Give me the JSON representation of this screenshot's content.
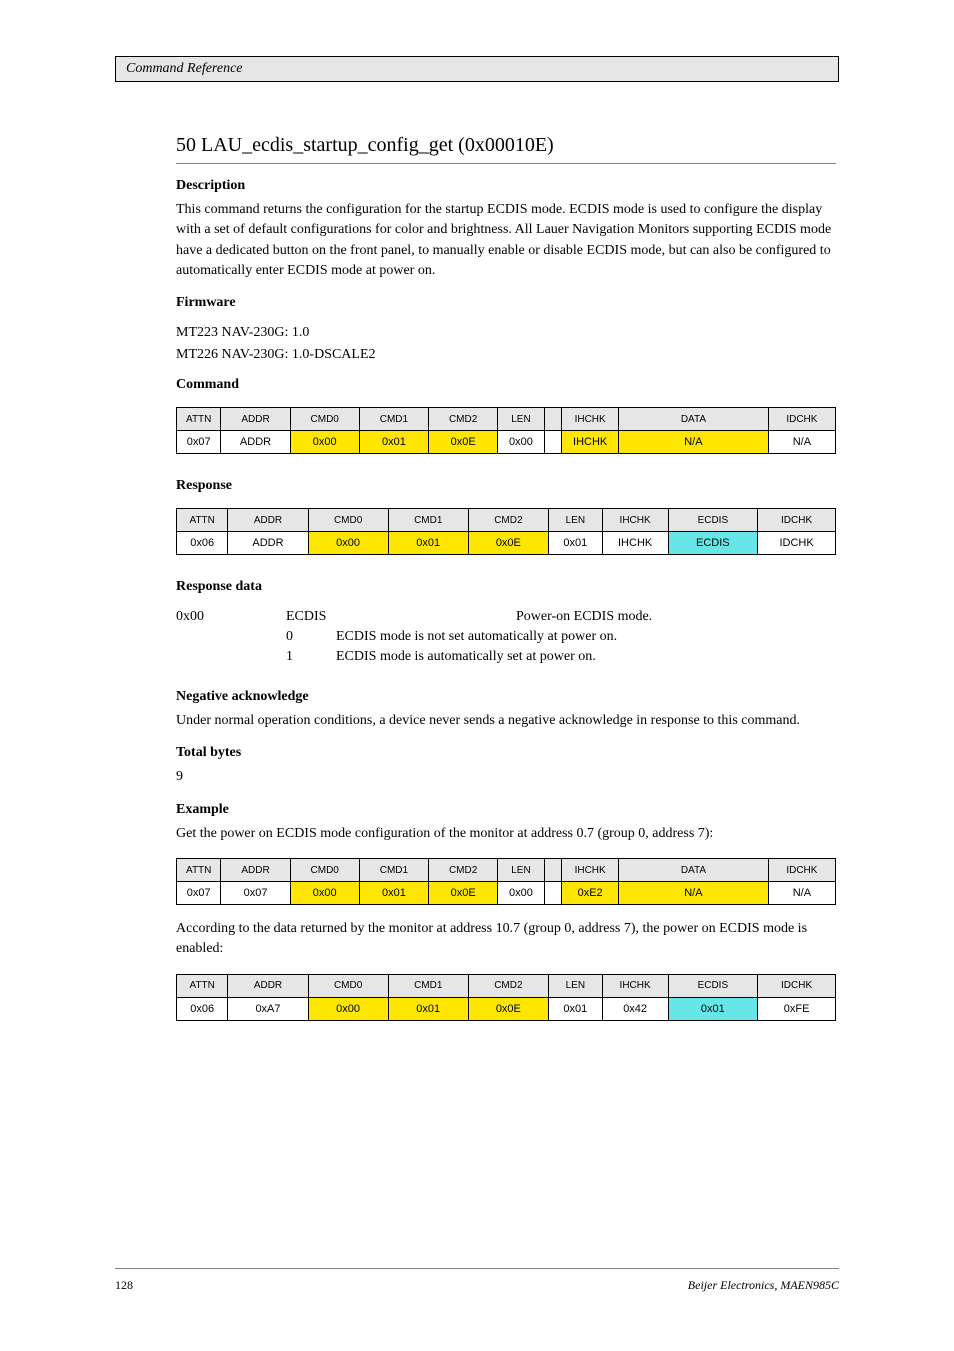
{
  "header": {
    "text": "Command Reference"
  },
  "section": {
    "title": "50 LAU_ecdis_startup_config_get (0x00010E)",
    "description_label": "Description",
    "description": "This command returns the configuration for the startup ECDIS mode. ECDIS mode is used to configure the display with a set of default configurations for color and brightness. All Lauer Navigation Monitors supporting ECDIS mode have a dedicated button on the front panel, to manually enable or disable ECDIS mode, but can also be configured to automatically enter ECDIS mode at power on.",
    "firmware_label": "Firmware",
    "firmware1": "MT223 NAV-230G: 1.0",
    "firmware2": "MT226 NAV-230G: 1.0-DSCALE2"
  },
  "command_label": "Command",
  "command_table": {
    "headers": [
      "ATTN",
      "ADDR",
      "CMD0",
      "CMD1",
      "CMD2",
      "LEN",
      "",
      "IHCHK",
      "DATA",
      "IDCHK"
    ],
    "cells": [
      "0x07",
      "ADDR",
      "0x00",
      "0x01",
      "0x0E",
      "0x00",
      "",
      "IHCHK",
      "N/A",
      "N/A"
    ]
  },
  "response_label": "Response",
  "response_table": {
    "headers": [
      "ATTN",
      "ADDR",
      "CMD0",
      "CMD1",
      "CMD2",
      "LEN",
      "IHCHK",
      "ECDIS",
      "IDCHK"
    ],
    "cells": [
      "0x06",
      "ADDR",
      "0x00",
      "0x01",
      "0x0E",
      "0x01",
      "IHCHK",
      "ECDIS",
      "IDCHK"
    ]
  },
  "response_data": {
    "label": "Response data",
    "row": {
      "hex": "0x00",
      "name": "ECDIS",
      "desc": "Power-on ECDIS mode."
    },
    "val0": {
      "v": "0",
      "d": "ECDIS mode is not set automatically at power on."
    },
    "val1": {
      "v": "1",
      "d": "ECDIS mode is automatically set at power on."
    }
  },
  "nak": {
    "label": "Negative acknowledge",
    "text": "Under normal operation conditions, a device never sends a negative acknowledge in response to this command."
  },
  "bytes": {
    "label": "Total bytes",
    "value": "9"
  },
  "example": {
    "label": "Example",
    "text1": "Get the power on ECDIS mode configuration of the monitor at address 0.7 (group 0, address 7):",
    "table1": {
      "headers": [
        "ATTN",
        "ADDR",
        "CMD0",
        "CMD1",
        "CMD2",
        "LEN",
        "",
        "IHCHK",
        "DATA",
        "IDCHK"
      ],
      "cells": [
        "0x07",
        "0x07",
        "0x00",
        "0x01",
        "0x0E",
        "0x00",
        "",
        "0xE2",
        "N/A",
        "N/A"
      ]
    },
    "text2": "According to the data returned by the monitor at address 10.7 (group 0, address 7), the power on ECDIS mode is enabled:",
    "table2": {
      "headers": [
        "ATTN",
        "ADDR",
        "CMD0",
        "CMD1",
        "CMD2",
        "LEN",
        "IHCHK",
        "ECDIS",
        "IDCHK"
      ],
      "cells": [
        "0x06",
        "0xA7",
        "0x00",
        "0x01",
        "0x0E",
        "0x01",
        "0x42",
        "0x01",
        "0xFE"
      ]
    }
  },
  "footer": {
    "left": "128",
    "right": "Beijer Electronics, MAEN985C"
  },
  "chart_data": {
    "type": "table",
    "tables": [
      {
        "name": "command",
        "columns": [
          "ATTN",
          "ADDR",
          "CMD0",
          "CMD1",
          "CMD2",
          "LEN",
          "",
          "IHCHK",
          "DATA",
          "IDCHK"
        ],
        "rows": [
          [
            "0x07",
            "ADDR",
            "0x00",
            "0x01",
            "0x0E",
            "0x00",
            "",
            "IHCHK",
            "N/A",
            "N/A"
          ]
        ]
      },
      {
        "name": "response",
        "columns": [
          "ATTN",
          "ADDR",
          "CMD0",
          "CMD1",
          "CMD2",
          "LEN",
          "IHCHK",
          "ECDIS",
          "IDCHK"
        ],
        "rows": [
          [
            "0x06",
            "ADDR",
            "0x00",
            "0x01",
            "0x0E",
            "0x01",
            "IHCHK",
            "ECDIS",
            "IDCHK"
          ]
        ]
      },
      {
        "name": "example_command",
        "columns": [
          "ATTN",
          "ADDR",
          "CMD0",
          "CMD1",
          "CMD2",
          "LEN",
          "",
          "IHCHK",
          "DATA",
          "IDCHK"
        ],
        "rows": [
          [
            "0x07",
            "0x07",
            "0x00",
            "0x01",
            "0x0E",
            "0x00",
            "",
            "0xE2",
            "N/A",
            "N/A"
          ]
        ]
      },
      {
        "name": "example_response",
        "columns": [
          "ATTN",
          "ADDR",
          "CMD0",
          "CMD1",
          "CMD2",
          "LEN",
          "IHCHK",
          "ECDIS",
          "IDCHK"
        ],
        "rows": [
          [
            "0x06",
            "0xA7",
            "0x00",
            "0x01",
            "0x0E",
            "0x01",
            "0x42",
            "0x01",
            "0xFE"
          ]
        ]
      }
    ]
  }
}
